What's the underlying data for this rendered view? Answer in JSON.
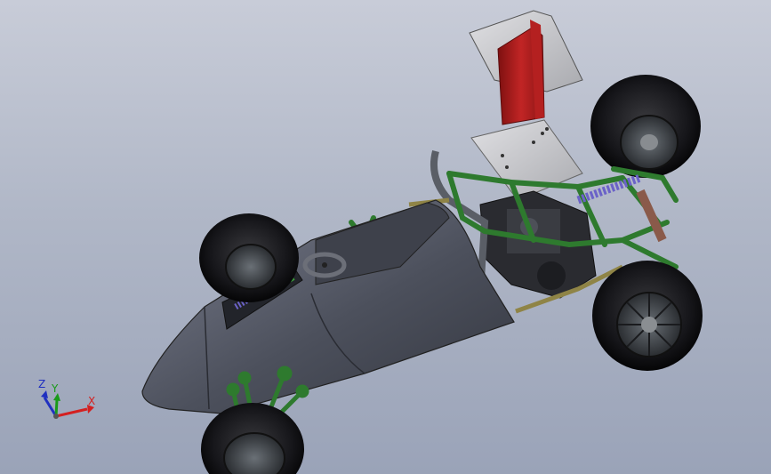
{
  "viewport": {
    "background_top": "#c8ccd8",
    "background_bottom": "#9aa3b8"
  },
  "model": {
    "body_color": "#4a4d58",
    "frame_color": "#2e7a2e",
    "wing_color": "#a81c1c",
    "panel_color": "#cfcfd2",
    "tire_color": "#1a1a1c",
    "spring_color": "#6b62c8"
  },
  "triad": {
    "x_label": "X",
    "y_label": "Y",
    "z_label": "Z",
    "x_color": "#d42020",
    "y_color": "#1a9a1a",
    "z_color": "#2030c0"
  }
}
